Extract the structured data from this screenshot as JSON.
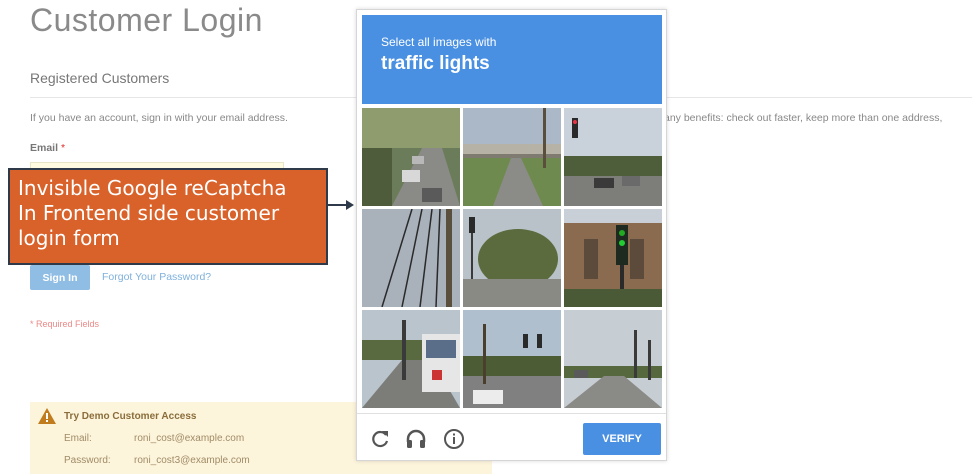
{
  "page": {
    "title": "Customer Login",
    "section_title": "Registered Customers",
    "intro_left": "If you have an account, sign in with your email address.",
    "intro_right": "any benefits: check out faster, keep more than one address,",
    "email_label": "Email",
    "required_star": "*",
    "signin_label": "Sign In",
    "forgot_label": "Forgot Your Password?",
    "required_note": "* Required Fields"
  },
  "demo": {
    "title": "Try Demo Customer Access",
    "email_label": "Email:",
    "email_value": "roni_cost@example.com",
    "password_label": "Password:",
    "password_value": "roni_cost3@example.com"
  },
  "callout": {
    "text": "Invisible Google reCaptcha\nIn Frontend side customer\nlogin form"
  },
  "captcha": {
    "instruction": "Select all images with",
    "target": "traffic lights",
    "verify_label": "VERIFY",
    "icons": [
      "reload-icon",
      "audio-icon",
      "info-icon"
    ],
    "accent_color": "#4a90e2"
  }
}
